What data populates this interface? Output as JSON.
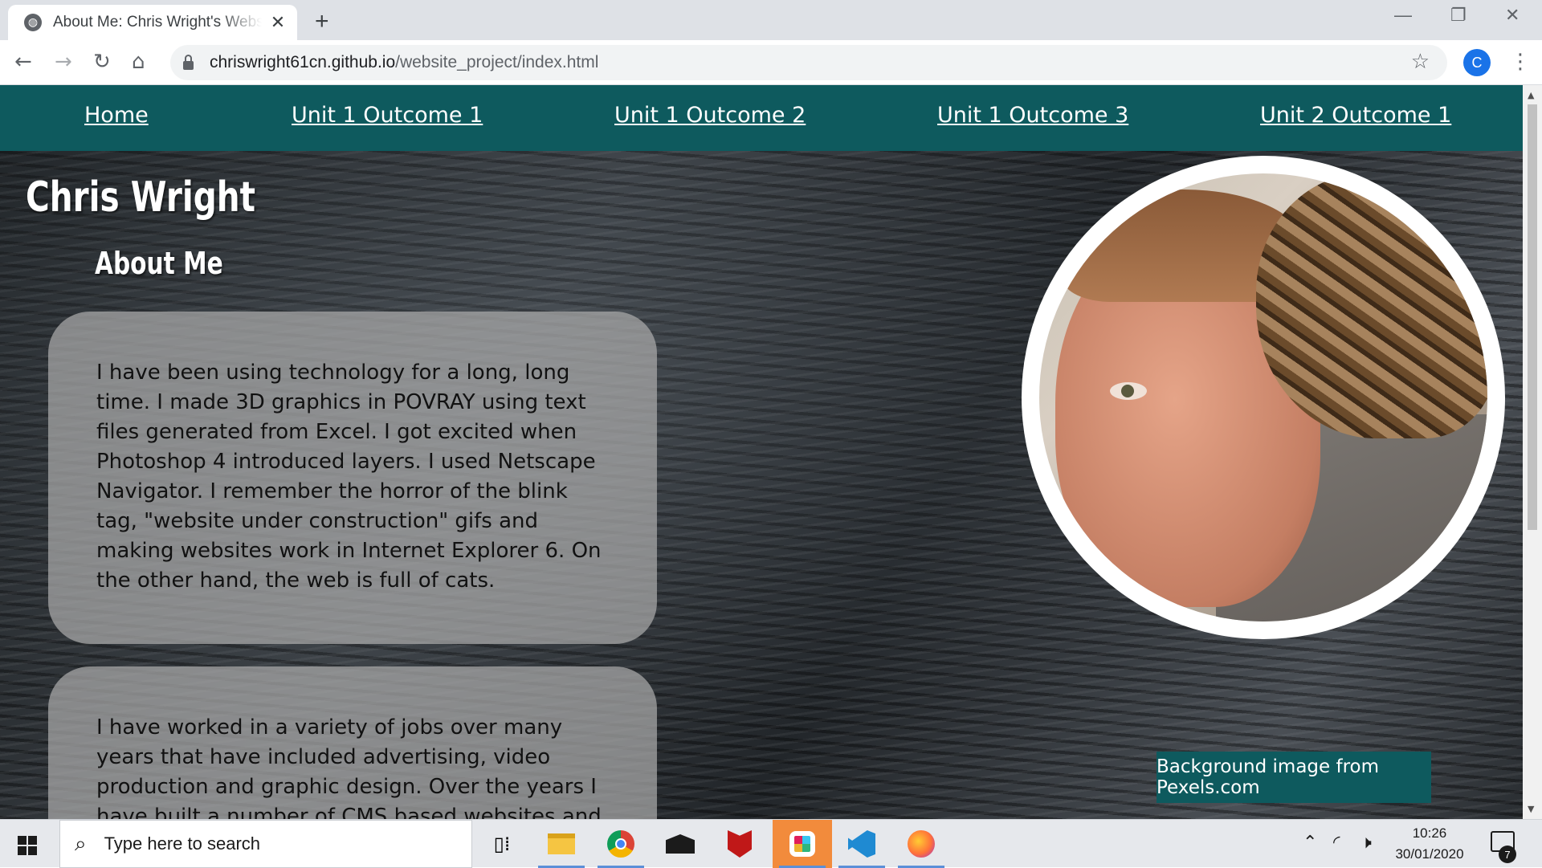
{
  "browser": {
    "tab_title": "About Me: Chris Wright's Website",
    "tab_close": "✕",
    "new_tab": "+",
    "url_host": "chriswright61cn.github.io",
    "url_path": "/website_project/index.html",
    "profile_initial": "C",
    "window_controls": {
      "minimize": "—",
      "restore": "❐",
      "close": "✕"
    }
  },
  "site": {
    "nav": [
      "Home",
      "Unit 1 Outcome 1",
      "Unit 1 Outcome 2",
      "Unit 1 Outcome 3",
      "Unit 2 Outcome 1"
    ],
    "name": "Chris Wright",
    "heading": "About Me",
    "paragraphs": [
      "I have been using technology for a long, long time. I made 3D graphics in POVRAY using text files generated from Excel. I got excited when Photoshop 4 introduced layers. I used Netscape Navigator. I remember the horror of the blink tag, \"website under construction\" gifs and making websites work in Internet Explorer 6. On the other hand, the web is full of cats.",
      "I have worked in a variety of jobs over many years that have included advertising, video production and graphic design. Over the years I have built a number of CMS based websites and focussed on"
    ],
    "credit": "Background image from Pexels.com",
    "photo_alt": "Portrait with cat"
  },
  "taskbar": {
    "search_placeholder": "Type here to search",
    "time": "10:26",
    "date": "30/01/2020",
    "notification_count": "7",
    "apps": [
      "task-view",
      "file-explorer",
      "chrome",
      "mail",
      "mcafee",
      "slack",
      "vscode",
      "firefox"
    ]
  }
}
